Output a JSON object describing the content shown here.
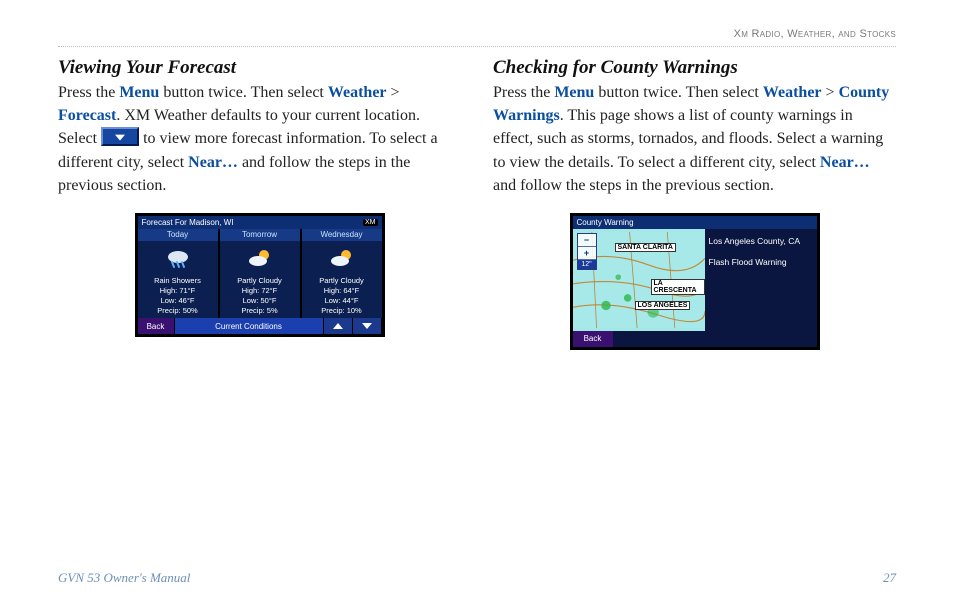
{
  "chapter": "Xm Radio, Weather, and Stocks",
  "footer": {
    "manual": "GVN 53 Owner's Manual",
    "page": "27"
  },
  "left": {
    "heading": "Viewing Your Forecast",
    "p": {
      "t1": "Press the ",
      "menu": "Menu",
      "t2": " button twice. Then select ",
      "weather": "Weather",
      "gt": " > ",
      "forecast": "Forecast",
      "t3": ". XM Weather defaults to your current location. Select ",
      "t4": " to view more forecast information. To select a different city, select ",
      "near": "Near…",
      "t5": " and follow the steps in the previous section."
    },
    "device": {
      "title": "Forecast For Madison, WI",
      "xm": "XM",
      "days": [
        {
          "name": "Today",
          "cond": "Rain Showers",
          "hi": "High: 71°F",
          "lo": "Low: 46°F",
          "precip": "Precip: 50%"
        },
        {
          "name": "Tomorrow",
          "cond": "Partly Cloudy",
          "hi": "High: 72°F",
          "lo": "Low: 50°F",
          "precip": "Precip: 5%"
        },
        {
          "name": "Wednesday",
          "cond": "Partly Cloudy",
          "hi": "High: 64°F",
          "lo": "Low: 44°F",
          "precip": "Precip: 10%"
        }
      ],
      "back": "Back",
      "cc": "Current Conditions"
    }
  },
  "right": {
    "heading": "Checking for County Warnings",
    "p": {
      "t1": "Press the ",
      "menu": "Menu",
      "t2": " button twice. Then select ",
      "weather": "Weather",
      "gt": " > ",
      "cw": "County Warnings",
      "t3": ". This page shows a list of county warnings in effect, such as storms, tornados, and floods. Select a warning to view the details. To select a different city, select ",
      "near": "Near…",
      "t4": " and follow the steps in the previous section."
    },
    "device": {
      "title": "County Warning",
      "zoom_minus": "−",
      "zoom_plus": "+",
      "zoom_scale": "12\"",
      "labels": {
        "sc": "SANTA CLARITA",
        "lc": "LA CRESCENTA",
        "la": "LOS ANGELES"
      },
      "panel_line1": "Los Angeles County, CA",
      "panel_line2": "Flash Flood Warning",
      "back": "Back"
    }
  }
}
